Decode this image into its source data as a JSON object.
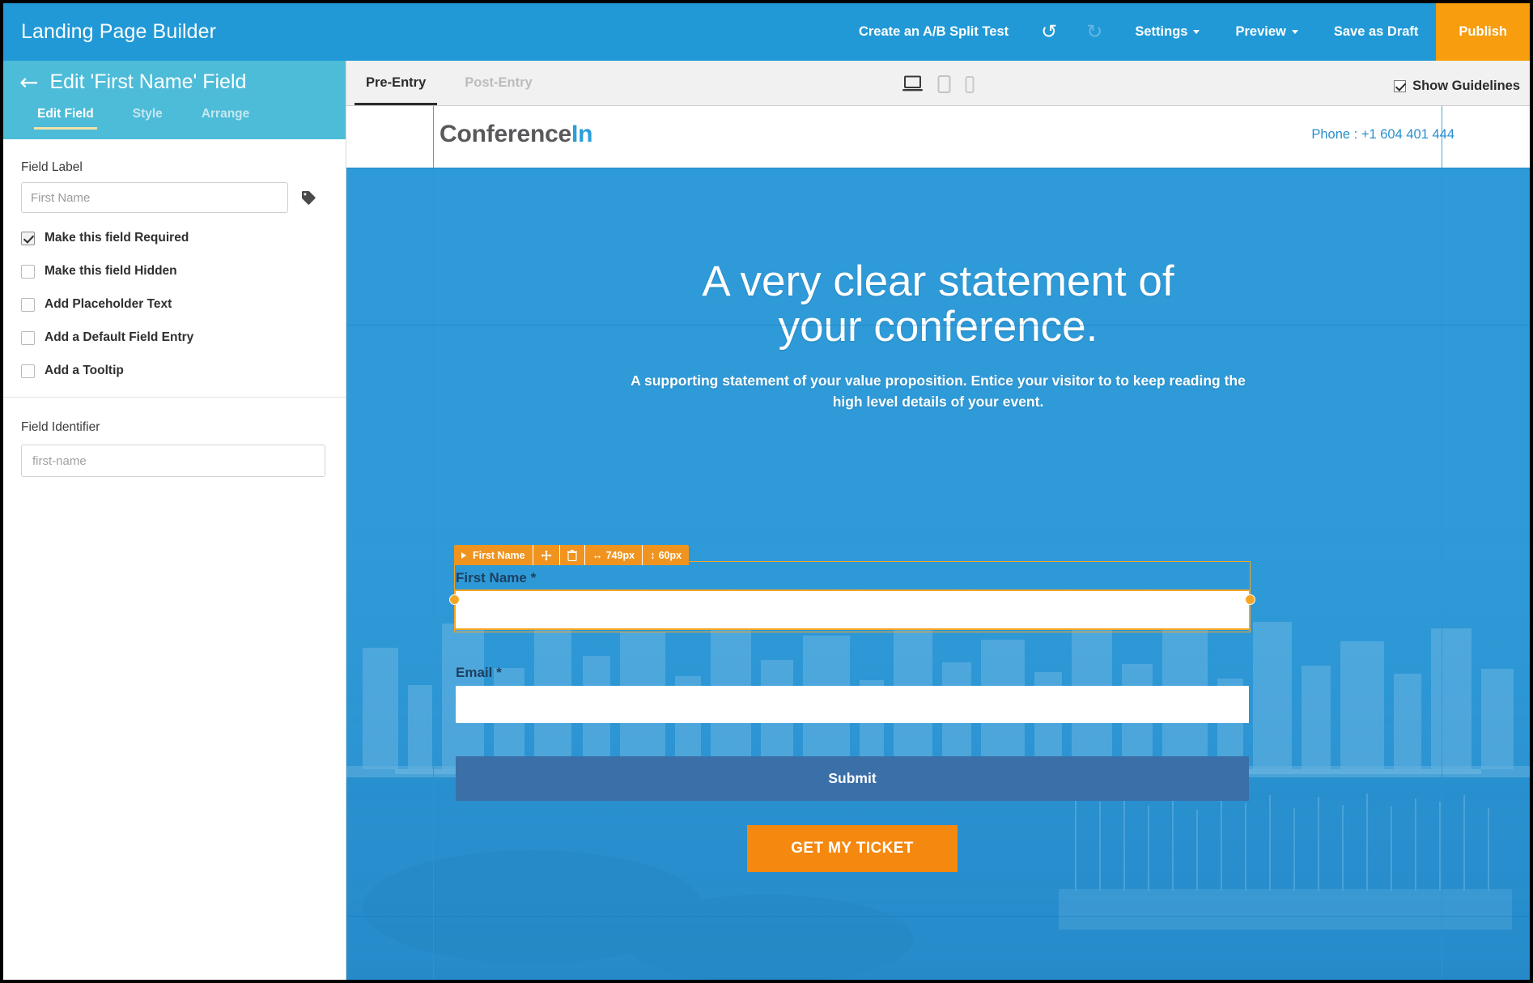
{
  "topbar": {
    "brand": "Landing Page Builder",
    "ab_test": "Create an A/B Split Test",
    "undo_icon": "↺",
    "redo_icon": "↻",
    "settings": "Settings",
    "preview": "Preview",
    "save_draft": "Save as Draft",
    "publish": "Publish",
    "bg_color": "#2199d6",
    "publish_color": "#f79d0e"
  },
  "sidebar": {
    "back_icon": "←",
    "title": "Edit 'First Name' Field",
    "header_color": "#4dbcd8",
    "tabs": [
      {
        "label": "Edit Field",
        "active": true
      },
      {
        "label": "Style",
        "active": false
      },
      {
        "label": "Arrange",
        "active": false
      }
    ],
    "field_label_caption": "Field Label",
    "field_label_value": "",
    "field_label_placeholder": "First Name",
    "tag_icon": "tag-icon",
    "options": [
      {
        "label": "Make this field Required",
        "checked": true
      },
      {
        "label": "Make this field Hidden",
        "checked": false
      },
      {
        "label": "Add Placeholder Text",
        "checked": false
      },
      {
        "label": "Add a Default Field Entry",
        "checked": false
      },
      {
        "label": "Add a Tooltip",
        "checked": false
      }
    ],
    "identifier_caption": "Field Identifier",
    "identifier_value": "",
    "identifier_placeholder": "first-name"
  },
  "canvas_toolbar": {
    "tabs": [
      {
        "label": "Pre-Entry",
        "active": true
      },
      {
        "label": "Post-Entry",
        "active": false
      }
    ],
    "devices": [
      {
        "name": "desktop-view-icon",
        "active": true
      },
      {
        "name": "tablet-view-icon",
        "active": false
      },
      {
        "name": "mobile-view-icon",
        "active": false
      }
    ],
    "guidelines_label": "Show Guidelines",
    "guidelines_checked": true
  },
  "page": {
    "logo_part1": "Conference",
    "logo_part2": "In",
    "phone": "Phone : +1 604 401 444",
    "headline_line1": "A very clear statement of",
    "headline_line2": "your conference.",
    "subheadline": "A supporting statement of your value proposition. Entice your visitor to to keep reading the high level details of your event.",
    "hero_bg_color": "#2f9ad8",
    "form": {
      "first_name_label": "First Name *",
      "first_name_value": "",
      "email_label": "Email *",
      "email_value": "",
      "submit_label": "Submit",
      "submit_color": "#3b6fa8",
      "ticket_label": "GET MY TICKET",
      "ticket_color": "#f5880f"
    },
    "selection": {
      "expand_icon": "▶",
      "name": "First Name",
      "move_icon": "✥",
      "delete_icon": "🗑",
      "width_icon": "↔",
      "width_value": "749px",
      "height_icon": "↕",
      "height_value": "60px",
      "accent_color": "#f0941f"
    }
  }
}
